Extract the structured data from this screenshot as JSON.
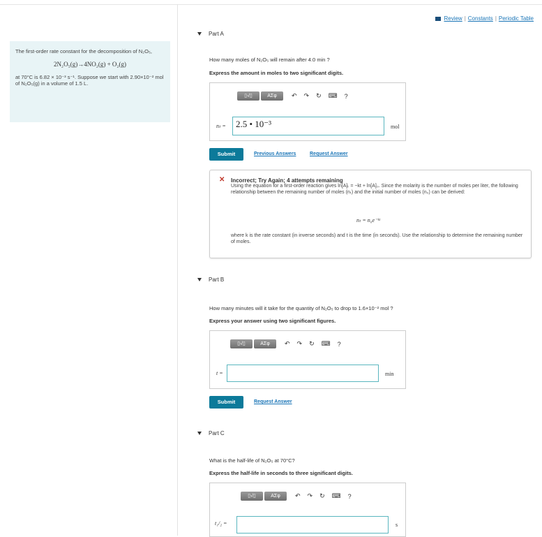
{
  "top_links": {
    "review": "Review",
    "constants": "Constants",
    "periodic_table": "Periodic Table"
  },
  "problem": {
    "intro": "The first-order rate constant for the decomposition of N₂O₅,",
    "equation": "2N₂O₅(g)→4NO₂(g) + O₂(g)",
    "text": "at 70°C is 6.82 × 10⁻³ s⁻¹. Suppose we start with 2.90×10⁻² mol of N₂O₅(g) in a volume of 1.5 L."
  },
  "toolbar": {
    "templates_label": "▯√▯",
    "symbols_label": "AΣφ",
    "undo": "↶",
    "redo": "↷",
    "reset": "↻",
    "keyboard": "⌨",
    "help": "?"
  },
  "part_a": {
    "title": "Part A",
    "question": "How many moles of N₂O₅ will remain after 4.0 min ?",
    "instruction": "Express the amount in moles to two significant digits.",
    "label": "nₜ =",
    "value": "2.5 • 10⁻³",
    "unit": "mol",
    "submit": "Submit",
    "previous_answers": "Previous Answers",
    "request_answer": "Request Answer",
    "feedback_title": "Incorrect; Try Again; 4 attempts remaining",
    "feedback_text": "Using the equation for a first-order reaction gives ln[A]ₜ = −kt + ln[A]₀. Since the molarity is the number of moles per liter, the following relationship between the remaining number of moles (nₜ) and the initial number of moles (n₀) can be derived:",
    "feedback_equation": "nₜ = n₀e⁻ᵏᵗ",
    "feedback_text2": "where k is the rate constant (in inverse seconds) and t is the time (in seconds). Use the relationship to determine the remaining number of moles."
  },
  "part_b": {
    "title": "Part B",
    "question": "How many minutes will it take for the quantity of N₂O₅ to drop to 1.6×10⁻² mol ?",
    "instruction": "Express your answer using two significant figures.",
    "label": "t =",
    "value": "",
    "unit": "min",
    "submit": "Submit",
    "request_answer": "Request Answer"
  },
  "part_c": {
    "title": "Part C",
    "question": "What is the half-life of N₂O₅ at 70°C?",
    "instruction": "Express the half-life in seconds to three significant digits.",
    "label": "t₁/₂ =",
    "value": "",
    "unit": "s"
  }
}
